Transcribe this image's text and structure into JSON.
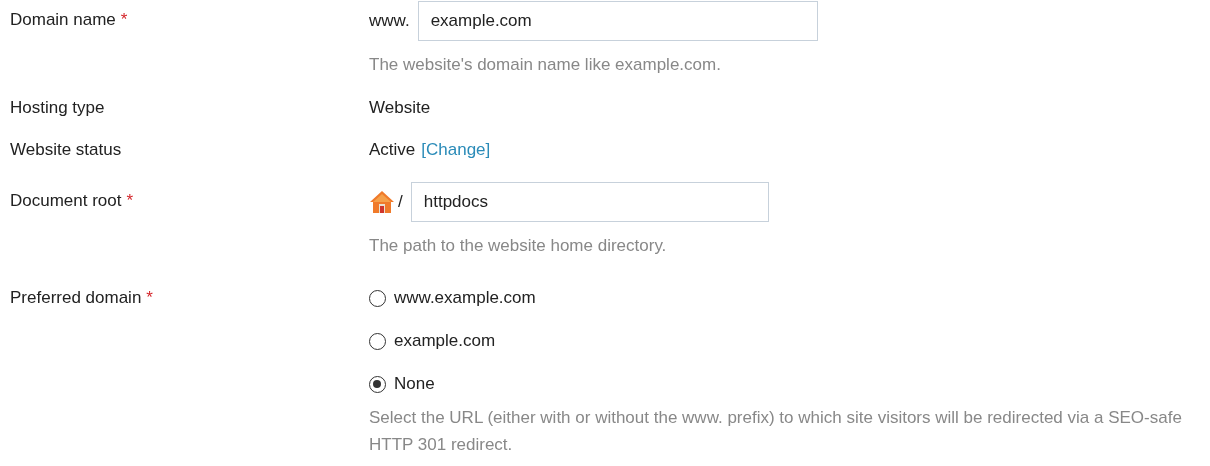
{
  "fields": [
    {
      "kind": "prefixed_input",
      "label": "Domain name",
      "required_mark": "*",
      "prefix": "www.",
      "value": "example.com",
      "hint": "The website's domain name like example.com."
    },
    {
      "kind": "text",
      "label": "Hosting type",
      "value": "Website"
    },
    {
      "kind": "status",
      "label": "Website status",
      "value": "Active",
      "link": "[Change]"
    },
    {
      "kind": "path_input",
      "label": "Document root",
      "required_mark": "*",
      "prefix": "/",
      "value": "httpdocs",
      "hint": "The path to the website home directory."
    },
    {
      "kind": "radios",
      "label": "Preferred domain",
      "required_mark": "*",
      "options": [
        {
          "label": "www.example.com",
          "selected": false
        },
        {
          "label": "example.com",
          "selected": false
        },
        {
          "label": "None",
          "selected": true
        }
      ],
      "hint": "Select the URL (either with or without the www. prefix) to which site visitors will be redirected via a SEO-safe HTTP 301 redirect."
    }
  ]
}
